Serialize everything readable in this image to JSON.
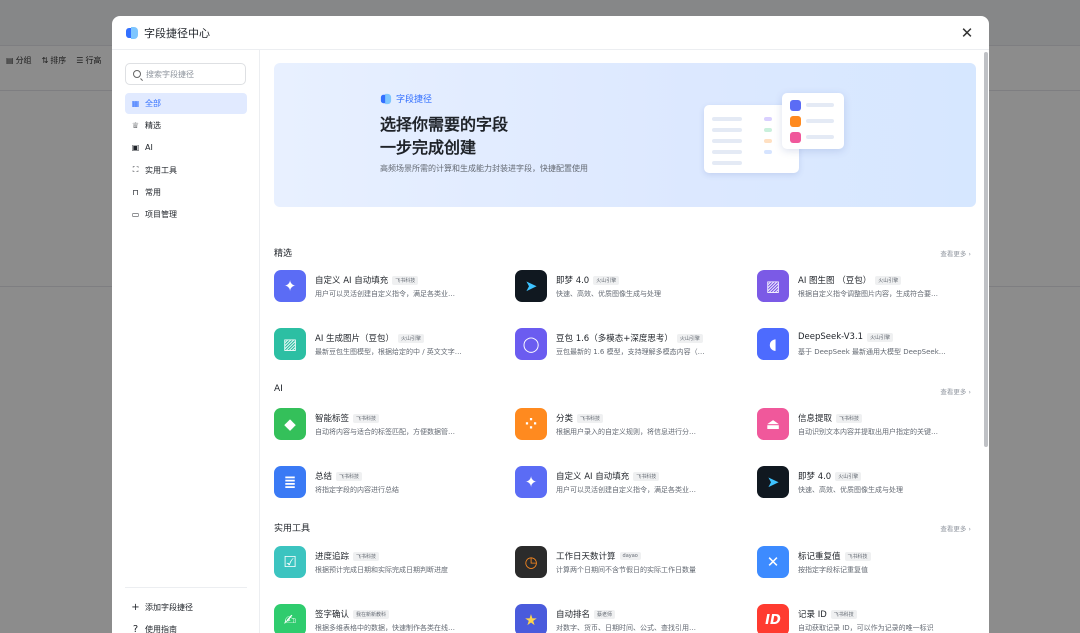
{
  "background": {
    "toolbar": [
      "分组",
      "排序",
      "行高"
    ]
  },
  "modal": {
    "title": "字段捷径中心",
    "close_icon": "close-icon"
  },
  "sidebar": {
    "search_placeholder": "搜索字段捷径",
    "items": [
      {
        "label": "全部",
        "icon": "grid-icon",
        "active": true
      },
      {
        "label": "精选",
        "icon": "trophy-icon",
        "active": false
      },
      {
        "label": "AI",
        "icon": "ai-icon",
        "active": false
      },
      {
        "label": "实用工具",
        "icon": "tool-icon",
        "active": false
      },
      {
        "label": "常用",
        "icon": "bookmark-icon",
        "active": false
      },
      {
        "label": "项目管理",
        "icon": "briefcase-icon",
        "active": false
      }
    ],
    "bottom": [
      {
        "label": "添加字段捷径",
        "icon": "plus-icon"
      },
      {
        "label": "使用指南",
        "icon": "help-icon"
      }
    ]
  },
  "banner": {
    "brand": "字段捷径",
    "title_line1": "选择你需要的字段",
    "title_line2": "一步完成创建",
    "subtitle": "高频场景所需的计算和生成能力封装进字段，快捷配置使用"
  },
  "sections": [
    {
      "title": "精选",
      "more": "查看更多 ›",
      "cards": [
        {
          "name": "自定义 AI 自动填充",
          "tag": "飞书科技",
          "desc": "用户可以灵活创建自定义指令，满足各类业…",
          "icon": "sparkle-icon",
          "color": "#5b6cf5"
        },
        {
          "name": "即梦 4.0",
          "tag": "火山引擎",
          "desc": "快速、高效、优质图像生成与处理",
          "icon": "jimeng-icon",
          "color": "#101820"
        },
        {
          "name": "AI 图生图 （豆包）",
          "tag": "火山引擎",
          "desc": "根据自定义指令调整图片内容，生成符合要…",
          "icon": "image-edit-icon",
          "color": "#7b5ae6"
        },
        {
          "name": "AI 生成图片（豆包）",
          "tag": "火山引擎",
          "desc": "最新豆包生图模型，根据给定的中 / 英文文字…",
          "icon": "image-icon",
          "color": "#2cbfa3"
        },
        {
          "name": "豆包 1.6（多模态+深度思考）",
          "tag": "火山引擎",
          "desc": "豆包最新的 1.6 模型，支持理解多模态内容（…",
          "icon": "doubao-icon",
          "color": "#6b5cf0"
        },
        {
          "name": "DeepSeek-V3.1",
          "tag": "火山引擎",
          "desc": "基于 DeepSeek 最新通用大模型 DeepSeek…",
          "icon": "deepseek-icon",
          "color": "#4d6bfe"
        }
      ]
    },
    {
      "title": "AI",
      "more": "查看更多 ›",
      "cards": [
        {
          "name": "智能标签",
          "tag": "飞书科技",
          "desc": "自动将内容与适合的标签匹配，方便数据管…",
          "icon": "tag-icon",
          "color": "#34c05a"
        },
        {
          "name": "分类",
          "tag": "飞书科技",
          "desc": "根据用户录入的自定义规则，将信息进行分…",
          "icon": "category-icon",
          "color": "#ff8a1f"
        },
        {
          "name": "信息提取",
          "tag": "飞书科技",
          "desc": "自动识别文本内容并提取出用户指定的关键…",
          "icon": "extract-icon",
          "color": "#f0589b"
        },
        {
          "name": "总结",
          "tag": "飞书科技",
          "desc": "将指定字段的内容进行总结",
          "icon": "summary-icon",
          "color": "#3a7af5"
        },
        {
          "name": "自定义 AI 自动填充",
          "tag": "飞书科技",
          "desc": "用户可以灵活创建自定义指令，满足各类业…",
          "icon": "sparkle-icon",
          "color": "#5b6cf5"
        },
        {
          "name": "即梦 4.0",
          "tag": "火山引擎",
          "desc": "快速、高效、优质图像生成与处理",
          "icon": "jimeng-icon",
          "color": "#101820"
        }
      ]
    },
    {
      "title": "实用工具",
      "more": "查看更多 ›",
      "cards": [
        {
          "name": "进度追踪",
          "tag": "飞书科技",
          "desc": "根据预计完成日期和实际完成日期判断进度",
          "icon": "checklist-icon",
          "color": "#3cc4c0"
        },
        {
          "name": "工作日天数计算",
          "tag": "dayao",
          "desc": "计算两个日期间不含节假日的实际工作日数量",
          "icon": "clock-icon",
          "color": "#2b2b2b"
        },
        {
          "name": "标记重复值",
          "tag": "飞书科技",
          "desc": "按指定字段标记重复值",
          "icon": "pin-icon",
          "color": "#3d8bff"
        },
        {
          "name": "签字确认",
          "tag": "我在新新教科",
          "desc": "根据多维表格中的数据，快速制作各类在线…",
          "icon": "sign-icon",
          "color": "#2fcc6e"
        },
        {
          "name": "自动排名",
          "tag": "蔡老师",
          "desc": "对数字、货币、日期时间、公式、查找引用…",
          "icon": "rank-icon",
          "color": "#4a5bdc"
        },
        {
          "name": "记录 ID",
          "tag": "飞书科技",
          "desc": "自动获取记录 ID，可以作为记录的唯一标识",
          "icon": "id-icon",
          "color": "#ff3b30"
        }
      ]
    }
  ]
}
